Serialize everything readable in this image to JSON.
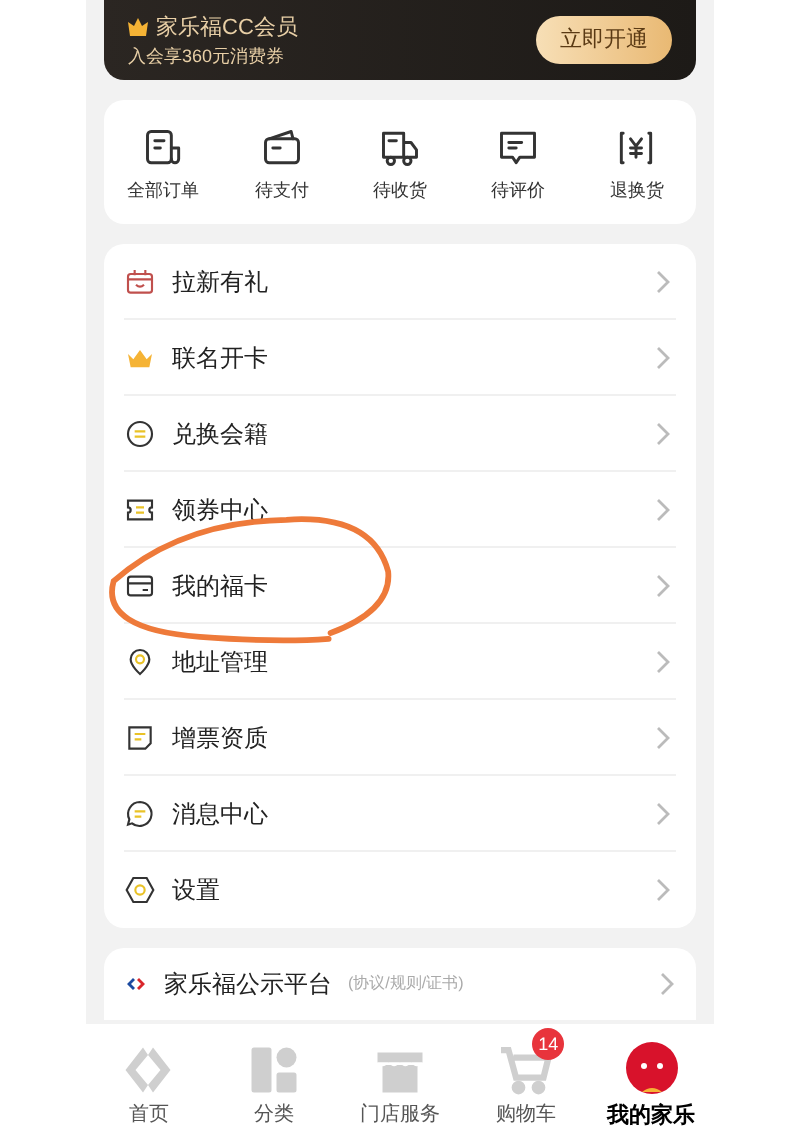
{
  "banner": {
    "title": "家乐福CC会员",
    "subtitle": "入会享360元消费券",
    "button": "立即开通"
  },
  "orders": [
    "全部订单",
    "待支付",
    "待收货",
    "待评价",
    "退换货"
  ],
  "menu": [
    "拉新有礼",
    "联名开卡",
    "兑换会籍",
    "领券中心",
    "我的福卡",
    "地址管理",
    "增票资质",
    "消息中心",
    "设置"
  ],
  "platform": {
    "title": "家乐福公示平台",
    "note": "(协议/规则/证书)"
  },
  "tabs": [
    {
      "label": "首页",
      "selected": false
    },
    {
      "label": "分类",
      "selected": false
    },
    {
      "label": "门店服务",
      "selected": false
    },
    {
      "label": "购物车",
      "selected": false,
      "badge": "14"
    },
    {
      "label": "我的家乐",
      "selected": true
    }
  ]
}
